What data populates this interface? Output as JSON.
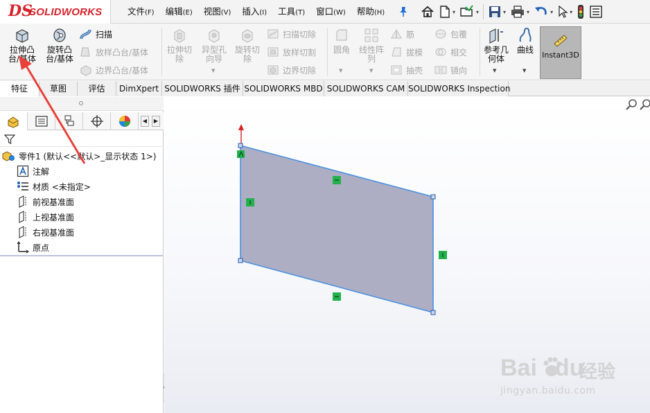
{
  "app": {
    "logo_ds": "DS",
    "logo_text": "SOLIDWORKS"
  },
  "menus": [
    {
      "label": "文件",
      "acc": "(F)"
    },
    {
      "label": "编辑",
      "acc": "(E)"
    },
    {
      "label": "视图",
      "acc": "(V)"
    },
    {
      "label": "插入",
      "acc": "(I)"
    },
    {
      "label": "工具",
      "acc": "(T)"
    },
    {
      "label": "窗口",
      "acc": "(W)"
    },
    {
      "label": "帮助",
      "acc": "(H)"
    }
  ],
  "quick_access": [
    "home-icon",
    "new-document-icon",
    "open-folder-icon",
    "save-icon",
    "print-icon",
    "undo-icon",
    "select-arrow-icon",
    "rebuild-traffic-light-icon",
    "options-icon"
  ],
  "ribbon": {
    "extrude_boss": "拉伸凸\n台/基体",
    "revolve_boss": "旋转凸\n台/基体",
    "sweep": "扫描",
    "loft_boss": "放样凸台/基体",
    "boundary_boss": "边界凸台/基体",
    "extrude_cut": "拉伸切\n除",
    "hole_wizard": "异型孔\n向导",
    "revolve_cut": "旋转切\n除",
    "swept_cut": "扫描切除",
    "lofted_cut": "放样切割",
    "boundary_cut": "边界切除",
    "fillet": "圆角",
    "linear_pattern": "线性阵\n列",
    "rib": "筋",
    "draft": "拔模",
    "shell": "抽壳",
    "wrap": "包覆",
    "intersect": "相交",
    "mirror": "镜向",
    "reference_geometry": "参考几\n何体",
    "curves": "曲线",
    "instant3d": "Instant3D"
  },
  "tabs": [
    {
      "label": "特征",
      "active": true
    },
    {
      "label": "草图"
    },
    {
      "label": "评估"
    },
    {
      "label": "DimXpert"
    },
    {
      "label": "SOLIDWORKS 插件"
    },
    {
      "label": "SOLIDWORKS MBD"
    },
    {
      "label": "SOLIDWORKS CAM"
    },
    {
      "label": "SOLIDWORKS Inspection"
    }
  ],
  "feature_tree": {
    "root": "零件1 (默认<<默认>_显示状态 1>)",
    "items": [
      {
        "label": "注解",
        "icon": "annotation-icon"
      },
      {
        "label": "材质 <未指定>",
        "icon": "material-icon"
      },
      {
        "label": "前视基准面",
        "icon": "plane-icon"
      },
      {
        "label": "上视基准面",
        "icon": "plane-icon"
      },
      {
        "label": "右视基准面",
        "icon": "plane-icon"
      },
      {
        "label": "原点",
        "icon": "origin-icon"
      }
    ]
  },
  "colors": {
    "brand_red": "#d8222a",
    "sketch_fill": "#adaec4",
    "sketch_edge": "#4a90e2",
    "relation_green": "#22b14c",
    "annotation_arrow": "#e8413a"
  },
  "watermark": {
    "brand": "Bai",
    "brand2": "du",
    "cn": "经验",
    "url": "jingyan.baidu.com"
  }
}
